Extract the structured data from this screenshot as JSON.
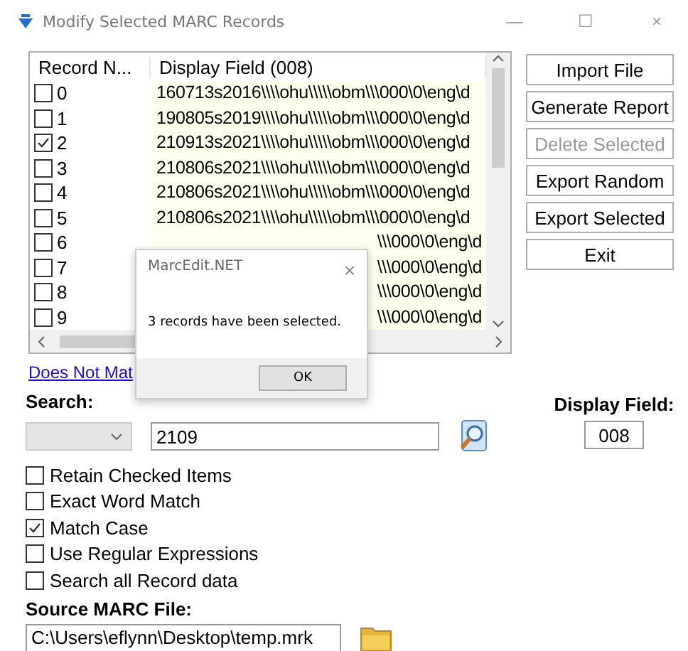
{
  "window": {
    "title": "Modify Selected MARC Records",
    "controls": [
      "—",
      "☐",
      "×"
    ]
  },
  "list": {
    "columns": [
      "Record N...",
      "Display Field (008)"
    ],
    "rows": [
      {
        "number": "0",
        "checked": false,
        "field": "160713s2016\\\\\\\\ohu\\\\\\\\\\obm\\\\\\000\\0\\eng\\d",
        "partial": false
      },
      {
        "number": "1",
        "checked": false,
        "field": "190805s2019\\\\\\\\ohu\\\\\\\\\\obm\\\\\\000\\0\\eng\\d",
        "partial": false
      },
      {
        "number": "2",
        "checked": true,
        "field": "210913s2021\\\\\\\\ohu\\\\\\\\\\obm\\\\\\000\\0\\eng\\d",
        "partial": false
      },
      {
        "number": "3",
        "checked": false,
        "field": "210806s2021\\\\\\\\ohu\\\\\\\\\\obm\\\\\\000\\0\\eng\\d",
        "partial": false
      },
      {
        "number": "4",
        "checked": false,
        "field": "210806s2021\\\\\\\\ohu\\\\\\\\\\obm\\\\\\000\\0\\eng\\d",
        "partial": false
      },
      {
        "number": "5",
        "checked": false,
        "field": "210806s2021\\\\\\\\ohu\\\\\\\\\\obm\\\\\\000\\0\\eng\\d",
        "partial": false
      },
      {
        "number": "6",
        "checked": false,
        "field": "\\\\\\000\\0\\eng\\d",
        "partial": true
      },
      {
        "number": "7",
        "checked": false,
        "field": "\\\\\\000\\0\\eng\\d",
        "partial": true
      },
      {
        "number": "8",
        "checked": false,
        "field": "\\\\\\000\\0\\eng\\d",
        "partial": true
      },
      {
        "number": "9",
        "checked": false,
        "field": "\\\\\\000\\0\\eng\\d",
        "partial": true
      }
    ]
  },
  "buttons": [
    {
      "label": "Import File",
      "disabled": false
    },
    {
      "label": "Generate Report",
      "disabled": false
    },
    {
      "label": "Delete Selected",
      "disabled": true
    },
    {
      "label": "Export Random",
      "disabled": false
    },
    {
      "label": "Export Selected",
      "disabled": false
    },
    {
      "label": "Exit",
      "disabled": false
    }
  ],
  "link": "Does Not Mat",
  "search": {
    "label": "Search:",
    "value": "2109"
  },
  "display_field": {
    "label": "Display Field:",
    "value": "008"
  },
  "options": [
    {
      "label": "Retain Checked Items",
      "checked": false
    },
    {
      "label": "Exact Word Match",
      "checked": false
    },
    {
      "label": "Match Case",
      "checked": true
    },
    {
      "label": "Use Regular Expressions",
      "checked": false
    },
    {
      "label": "Search all Record data",
      "checked": false
    }
  ],
  "source": {
    "label": "Source MARC File:",
    "value": "C:\\Users\\eflynn\\Desktop\\temp.mrk"
  },
  "dialog": {
    "title": "MarcEdit.NET",
    "close": "×",
    "message": "3 records have been selected.",
    "button": "OK"
  }
}
